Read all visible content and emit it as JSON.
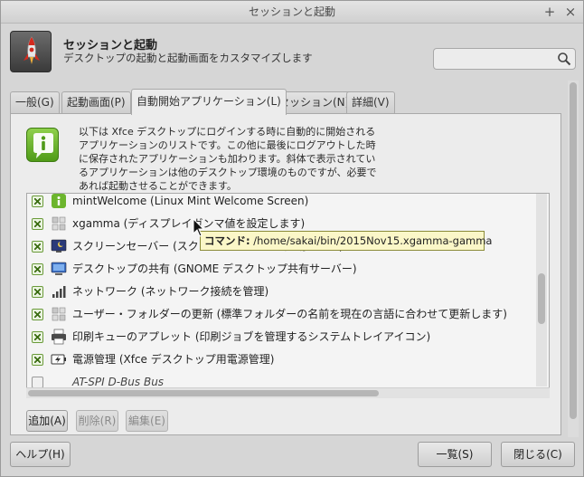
{
  "window": {
    "title": "セッションと起動"
  },
  "header": {
    "title": "セッションと起動",
    "subtitle": "デスクトップの起動と起動画面をカスタマイズします",
    "search_placeholder": ""
  },
  "tabs": [
    {
      "label": "一般(G)",
      "active": false
    },
    {
      "label": "起動画面(P)",
      "active": false
    },
    {
      "label": "自動開始アプリケーション(L)",
      "active": true
    },
    {
      "label": "セッション(N)",
      "active": false
    },
    {
      "label": "詳細(V)",
      "active": false
    }
  ],
  "info": {
    "text": "以下は Xfce デスクトップにログインする時に自動的に開始されるアプリケーションのリストです。この他に最後にログアウトした時に保存されたアプリケーションも加わります。斜体で表示されているアプリケーションは他のデスクトップ環境のものですが、必要であれば起動させることができます。"
  },
  "autostart": [
    {
      "label": "mintWelcome (Linux Mint Welcome Screen)",
      "checked": true,
      "icon": "mint-welcome-icon",
      "italic": false
    },
    {
      "label": "xgamma (ディスプレイガンマ値を設定します)",
      "checked": true,
      "icon": "generic-app-icon",
      "italic": false
    },
    {
      "label": "スクリーンセーバー (スクリーンセーバーを起動します)",
      "checked": true,
      "icon": "screensaver-icon",
      "italic": false
    },
    {
      "label": "デスクトップの共有 (GNOME デスクトップ共有サーバー)",
      "checked": true,
      "icon": "desktop-sharing-icon",
      "italic": false
    },
    {
      "label": "ネットワーク (ネットワーク接続を管理)",
      "checked": true,
      "icon": "network-signal-icon",
      "italic": false
    },
    {
      "label": "ユーザー・フォルダーの更新 (標準フォルダーの名前を現在の言語に合わせて更新します)",
      "checked": true,
      "icon": "generic-app-icon",
      "italic": false
    },
    {
      "label": "印刷キューのアプレット (印刷ジョブを管理するシステムトレイアイコン)",
      "checked": true,
      "icon": "printer-icon",
      "italic": false
    },
    {
      "label": "電源管理 (Xfce デスクトップ用電源管理)",
      "checked": true,
      "icon": "battery-icon",
      "italic": false
    },
    {
      "label": "AT-SPI D-Bus Bus",
      "checked": false,
      "icon": "",
      "italic": true
    }
  ],
  "tooltip": {
    "key": "コマンド:",
    "value": " /home/sakai/bin/2015Nov15.xgamma-gamma"
  },
  "list_buttons": {
    "add": "追加(A)",
    "remove": "削除(R)",
    "edit": "編集(E)"
  },
  "footer": {
    "help": "ヘルプ(H)",
    "list": "一覧(S)",
    "close": "閉じる(C)"
  },
  "colors": {
    "accent_green": "#5ea81f",
    "tooltip_bg": "#fbf7c8"
  }
}
